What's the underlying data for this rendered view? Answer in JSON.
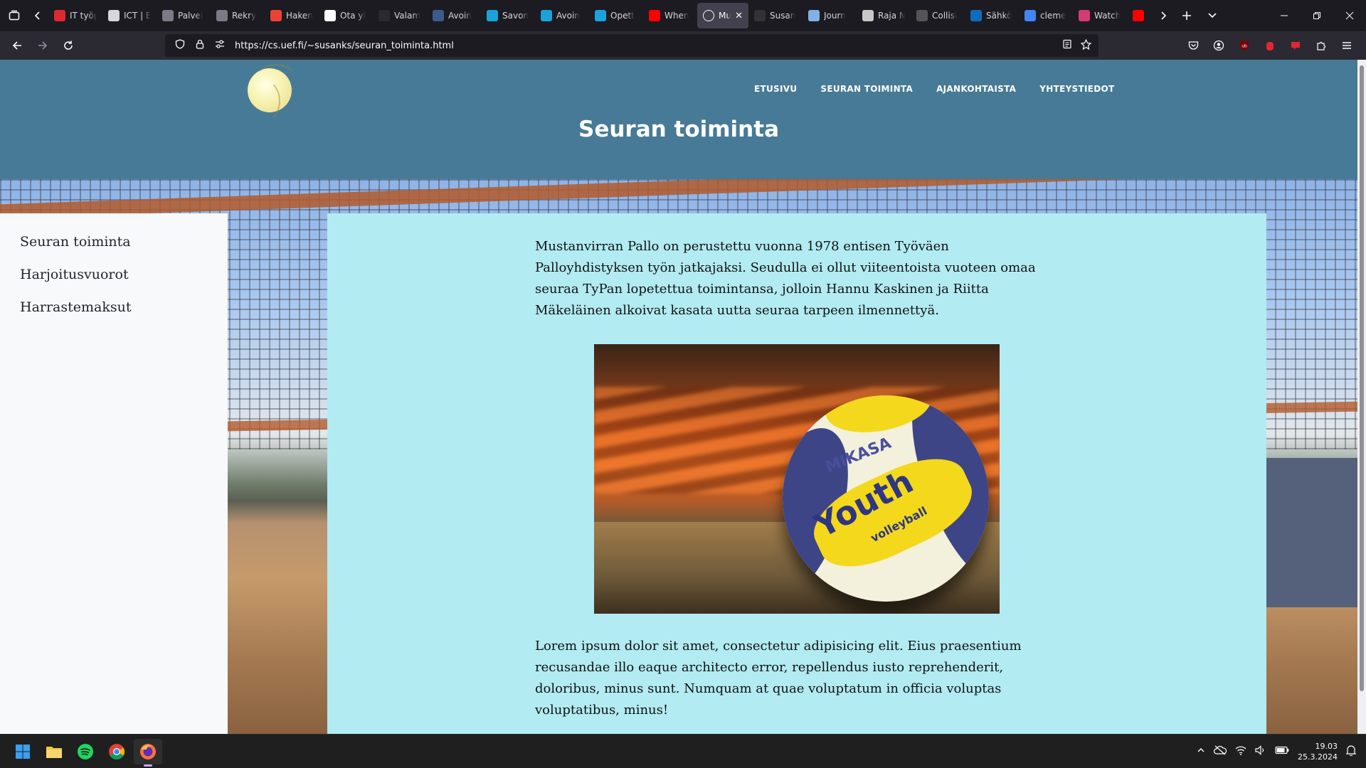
{
  "browser": {
    "tabs": [
      {
        "label": "IT työp",
        "icon": "red-figure-favicon",
        "color": "#e0282e"
      },
      {
        "label": "ICT | E",
        "icon": "menu-lines-favicon",
        "color": "#d6d6dc"
      },
      {
        "label": "Palvel",
        "icon": "folder-favicon",
        "color": "#7a7a88"
      },
      {
        "label": "Rekry",
        "icon": "folder-favicon",
        "color": "#7a7a88"
      },
      {
        "label": "Haken",
        "icon": "gmail-favicon",
        "color": "#ea4335"
      },
      {
        "label": "Ota yl",
        "icon": "h-favicon",
        "color": "#ffffff"
      },
      {
        "label": "Valam",
        "icon": "arch-favicon",
        "color": "#2b2a33"
      },
      {
        "label": "Avoin",
        "icon": "book-favicon",
        "color": "#3b5b8c"
      },
      {
        "label": "Savon",
        "icon": "ring-favicon",
        "color": "#1aa3d9"
      },
      {
        "label": "Avoin",
        "icon": "ring-favicon",
        "color": "#1aa3d9"
      },
      {
        "label": "Opett",
        "icon": "ring-favicon",
        "color": "#1aa3d9"
      },
      {
        "label": "When",
        "icon": "youtube-favicon",
        "color": "#ff0000"
      },
      {
        "label": "Mu",
        "icon": "globe-favicon",
        "color": "#fbfbfe",
        "active": true
      },
      {
        "label": "Susan",
        "icon": "github-favicon",
        "color": "#333333"
      },
      {
        "label": "Journ",
        "icon": "cloud-favicon",
        "color": "#7fb2e6"
      },
      {
        "label": "Raja N",
        "icon": "image-favicon",
        "color": "#c7c7c7"
      },
      {
        "label": "Collisi",
        "icon": "shape-favicon",
        "color": "#555555"
      },
      {
        "label": "Sähkö",
        "icon": "outlook-favicon",
        "color": "#0f6cbd"
      },
      {
        "label": "cleme",
        "icon": "google-favicon",
        "color": "#4285f4"
      },
      {
        "label": "Watch",
        "icon": "k-favicon",
        "color": "#d43c76"
      },
      {
        "label": "",
        "icon": "youtube-favicon",
        "color": "#ff0000"
      }
    ],
    "url": "https://cs.uef.fi/~susanks/seuran_toiminta.html"
  },
  "site": {
    "menu": [
      "ETUSIVU",
      "SEURAN TOIMINTA",
      "AJANKOHTAISTA",
      "YHTEYSTIEDOT"
    ],
    "page_title": "Seuran toiminta",
    "sidebar": [
      "Seuran toiminta",
      "Harjoitusvuorot",
      "Harrastemaksut"
    ],
    "paragraph1": "Mustanvirran Pallo on perustettu vuonna 1978 entisen Työväen Palloyhdistyksen työn jatkajaksi. Seudulla ei ollut viiteentoista vuoteen omaa seuraa TyPan lopetettua toimintansa, jolloin Hannu Kaskinen ja Riitta Mäkeläinen alkoivat kasata uutta seuraa tarpeen ilmennettyä.",
    "ball_text": {
      "brand": "MIKASA",
      "model": "Youth",
      "sub": "volleyball"
    },
    "paragraph2": "Lorem ipsum dolor sit amet, consectetur adipisicing elit. Eius praesentium recusandae illo eaque architecto error, repellendus iusto reprehenderit, doloribus, minus sunt. Numquam at quae voluptatum in officia voluptas voluptatibus, minus!",
    "colors": {
      "header": "#477a96",
      "content_bg": "#b2ebf2",
      "sidebar_bg": "#f8f9fa"
    }
  },
  "taskbar": {
    "apps": [
      "windows-start-icon",
      "file-explorer-icon",
      "spotify-icon",
      "chrome-icon",
      "firefox-icon"
    ],
    "time": "19.03",
    "date": "25.3.2024"
  }
}
